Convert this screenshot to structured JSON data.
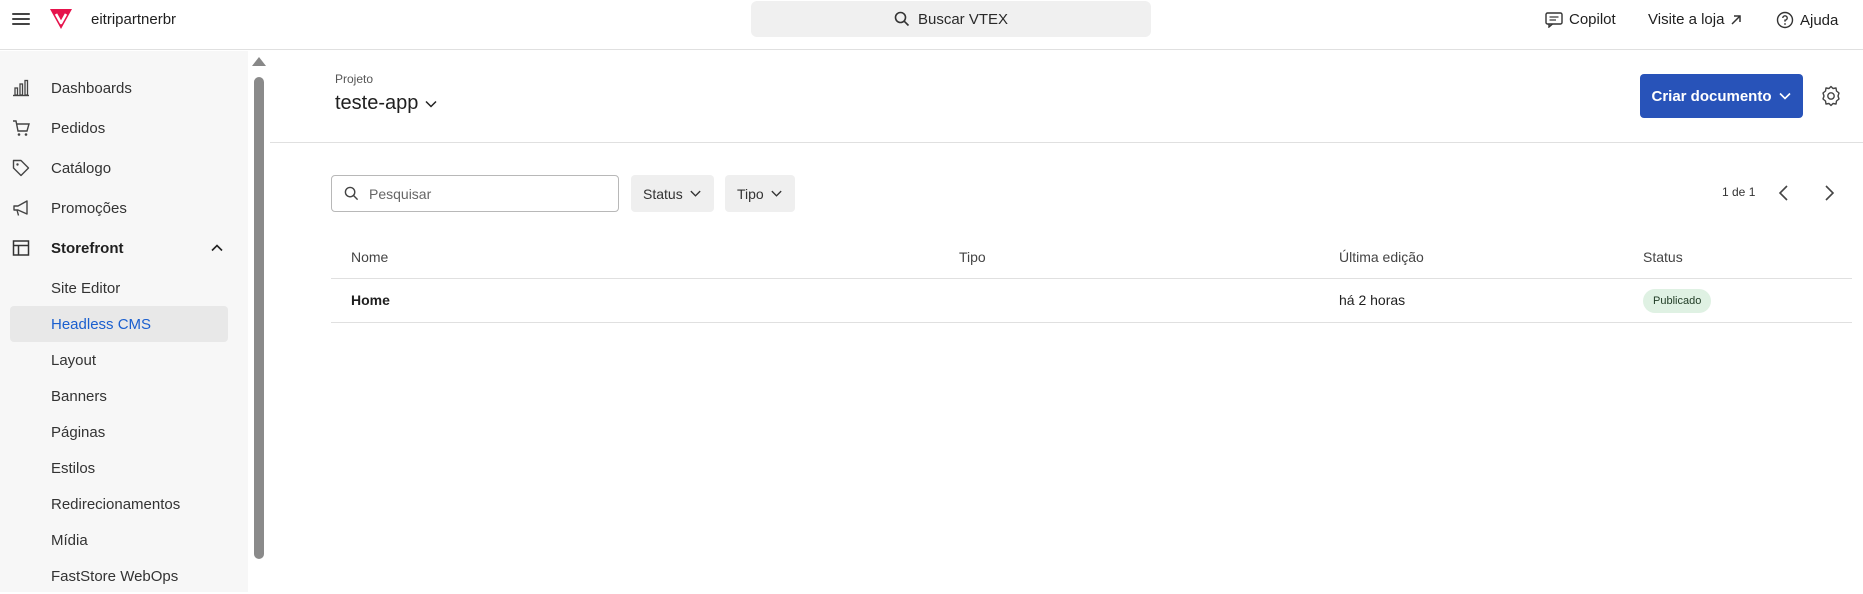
{
  "topbar": {
    "account_name": "eitripartnerbr",
    "search_label": "Buscar VTEX",
    "copilot_label": "Copilot",
    "visit_store_label": "Visite a loja",
    "help_label": "Ajuda",
    "brand_color": "#e6134c"
  },
  "sidebar": {
    "items": [
      {
        "label": "Dashboards",
        "icon": "bar-chart-icon"
      },
      {
        "label": "Pedidos",
        "icon": "cart-icon"
      },
      {
        "label": "Catálogo",
        "icon": "tag-icon"
      },
      {
        "label": "Promoções",
        "icon": "megaphone-icon"
      },
      {
        "label": "Storefront",
        "icon": "layout-icon",
        "expanded": true
      }
    ],
    "subitems": [
      {
        "label": "Site Editor"
      },
      {
        "label": "Headless CMS",
        "active": true
      },
      {
        "label": "Layout"
      },
      {
        "label": "Banners"
      },
      {
        "label": "Páginas"
      },
      {
        "label": "Estilos"
      },
      {
        "label": "Redirecionamentos"
      },
      {
        "label": "Mídia"
      },
      {
        "label": "FastStore WebOps"
      }
    ]
  },
  "main": {
    "project_label": "Projeto",
    "project_name": "teste-app",
    "create_button": "Criar documento",
    "search_placeholder": "Pesquisar",
    "filters": [
      "Status",
      "Tipo"
    ],
    "pagination": "1 de 1",
    "table": {
      "headers": [
        "Nome",
        "Tipo",
        "Última edição",
        "Status"
      ],
      "rows": [
        {
          "name": "Home",
          "type": "",
          "last_edit": "há 2 horas",
          "status": "Publicado"
        }
      ]
    },
    "accent_color": "#2853b9",
    "status_color": "#dff1e3"
  }
}
